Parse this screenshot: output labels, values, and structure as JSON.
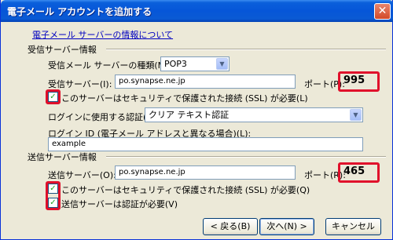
{
  "window": {
    "title": "電子メール アカウントを追加する",
    "close_label": "✕"
  },
  "info_link": "電子メール サーバーの情報について",
  "incoming": {
    "section_title": "受信サーバー情報",
    "type_label": "受信メール サーバーの種類(M):",
    "type_value": "POP3",
    "server_label": "受信サーバー(I):",
    "server_value": "po.synapse.ne.jp",
    "port_label": "ポート(P):",
    "port_value": "995",
    "ssl_label": "このサーバーはセキュリティで保護された接続 (SSL) が必要(L)",
    "ssl_checked": true,
    "auth_label": "ログインに使用する認証(U):",
    "auth_value": "クリア テキスト認証",
    "login_id_label": "ログイン ID (電子メール アドレスと異なる場合)(L):",
    "login_id_value": "example"
  },
  "outgoing": {
    "section_title": "送信サーバー情報",
    "server_label": "送信サーバー(O):",
    "server_value": "po.synapse.ne.jp",
    "port_label": "ポート(R):",
    "port_value": "465",
    "ssl_label": "このサーバーはセキュリティで保護された接続 (SSL) が必要(Q)",
    "ssl_checked": true,
    "auth_required_label": "送信サーバーは認証が必要(V)",
    "auth_required_checked": true
  },
  "buttons": {
    "back": "< 戻る(B)",
    "next": "次へ(N) >",
    "cancel": "キャンセル"
  },
  "check_mark": "✓",
  "dropdown_glyph": "▼",
  "colors": {
    "highlight": "#e0102b",
    "title_bar": "#0656d8",
    "link": "#0000c0"
  }
}
